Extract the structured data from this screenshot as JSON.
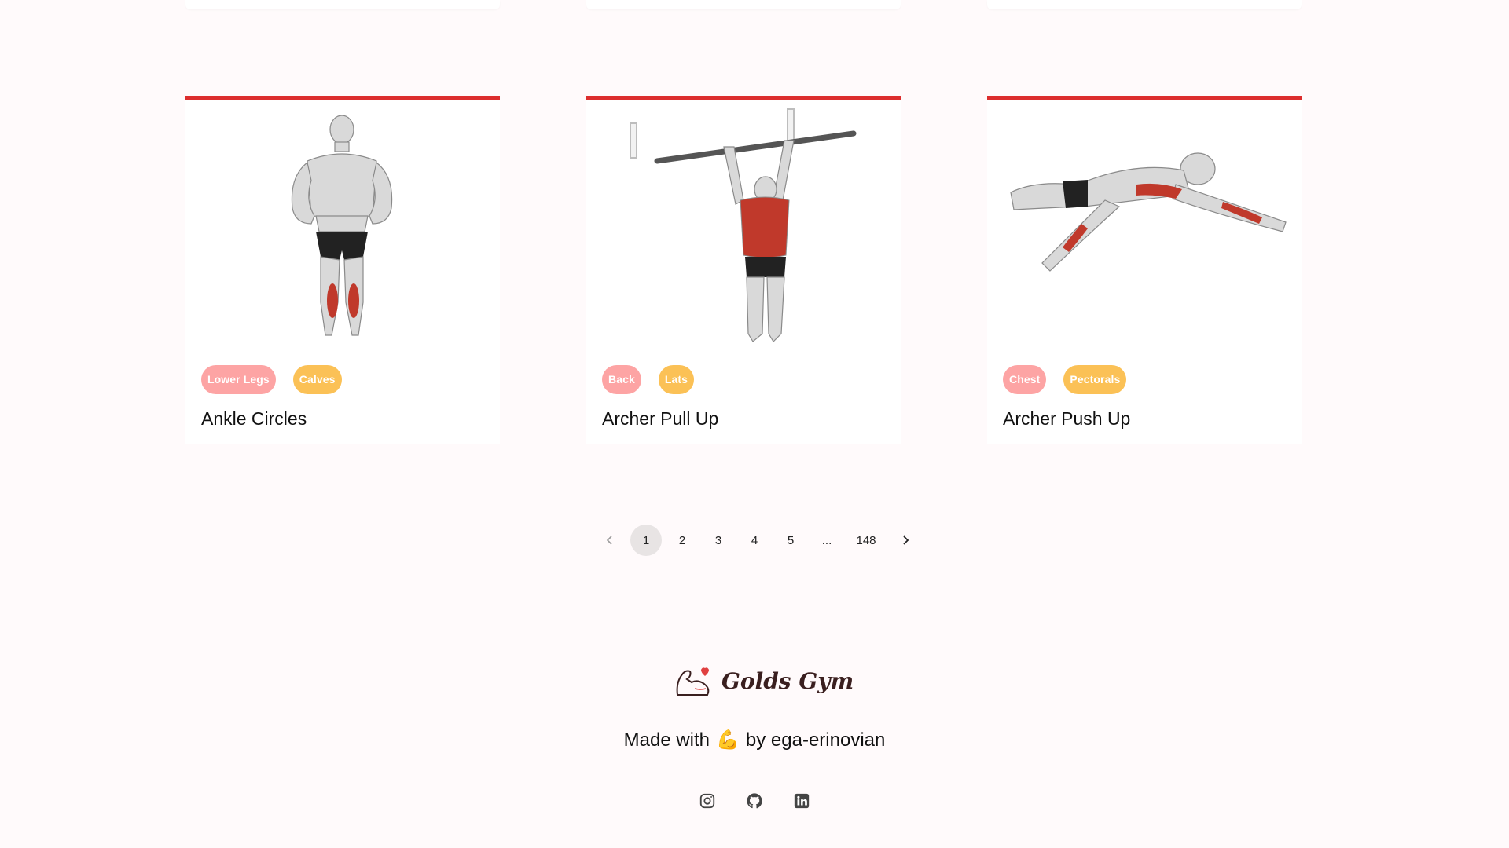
{
  "cards": [
    {
      "tags": [
        "Lower Legs",
        "Calves"
      ],
      "title": "Ankle Circles",
      "image_icon": "ankle-circles-illustration"
    },
    {
      "tags": [
        "Back",
        "Lats"
      ],
      "title": "Archer Pull Up",
      "image_icon": "archer-pull-up-illustration"
    },
    {
      "tags": [
        "Chest",
        "Pectorals"
      ],
      "title": "Archer Push Up",
      "image_icon": "archer-push-up-illustration"
    }
  ],
  "pagination": {
    "prev_icon": "chevron-left-icon",
    "pages": [
      "1",
      "2",
      "3",
      "4",
      "5",
      "...",
      "148"
    ],
    "current": "1",
    "next_icon": "chevron-right-icon"
  },
  "footer": {
    "brand": "Golds Gym",
    "made_with": "Made with",
    "emoji": "💪",
    "by": "by ega-erinovian",
    "socials": [
      "instagram-icon",
      "github-icon",
      "linkedin-icon"
    ]
  },
  "colors": {
    "accent": "#dc2d2d",
    "tag_primary": "#fda4a4",
    "tag_secondary": "#fbc156",
    "background": "#fffafb"
  }
}
